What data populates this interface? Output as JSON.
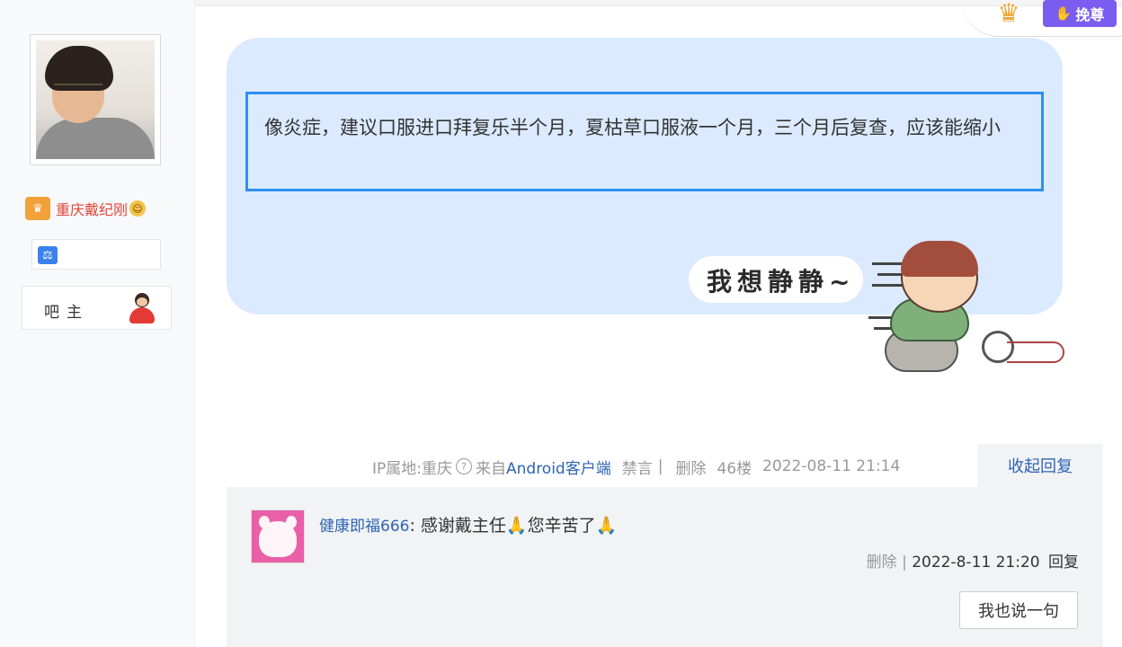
{
  "author": {
    "username": "重庆戴纪刚",
    "role_label": "吧主",
    "level_icon": "balance-icon",
    "badge_icon": "crown-badge-icon"
  },
  "top_badges": {
    "vip_label": "挽尊",
    "vip_icon": "hand-icon",
    "crown_icon": "crown-icon"
  },
  "post": {
    "content": "像炎症，建议口服进口拜复乐半个月，夏枯草口服液一个月，三个月后复查，应该能缩小",
    "sticker_text": "我想静静~"
  },
  "meta": {
    "ip_location": "IP属地:重庆",
    "from_prefix": "来自",
    "client": "Android客户端",
    "ban": "禁言",
    "delete": "删除",
    "floor": "46楼",
    "datetime": "2022-08-11 21:14",
    "collapse_reply": "收起回复"
  },
  "reply": {
    "username": "健康即福666",
    "text": "感谢戴主任",
    "text2": "您辛苦了",
    "emoji": "🙏",
    "delete": "删除",
    "datetime": "2022-8-11 21:20",
    "reply_label": "回复",
    "say_button": "我也说一句"
  },
  "colors": {
    "accent_blue": "#2f8ff0",
    "bubble_bg": "#dbeafe",
    "link": "#2d64b3",
    "username_red": "#e0473a",
    "vip_purple": "#7a5cf0"
  }
}
